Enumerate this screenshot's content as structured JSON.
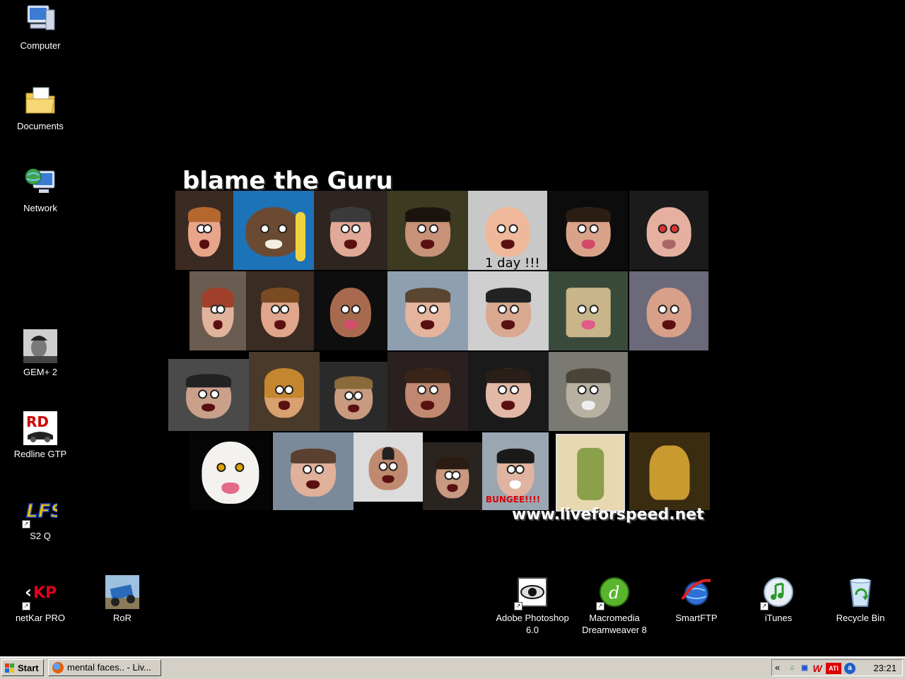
{
  "desktop": {
    "icons": {
      "computer": "Computer",
      "documents": "Documents",
      "network": "Network",
      "gem": "GEM+ 2",
      "redline": "Redline GTP",
      "s2q": "S2 Q",
      "netkar": "netKar PRO",
      "ror": "RoR",
      "photoshop_line1": "Adobe Photoshop",
      "photoshop_line2": "6.0",
      "dreamweaver_line1": "Macromedia",
      "dreamweaver_line2": "Dreamweaver 8",
      "smartftp": "SmartFTP",
      "itunes": "iTunes",
      "recycle": "Recycle Bin"
    },
    "wallpaper": {
      "title": "blame the Guru",
      "url": "www.liveforspeed.net",
      "caption": "1 day !!!",
      "bungee": "BUNGEE!!!!"
    }
  },
  "taskbar": {
    "start_label": "Start",
    "window_button": "mental faces.. - Liv...",
    "tray_chevron": "«",
    "clock": "23:21"
  },
  "icon_names": [
    "computer-icon",
    "folder-icon",
    "network-icon",
    "gem-icon",
    "redline-icon",
    "lfs-icon",
    "netkar-icon",
    "ror-icon",
    "photoshop-icon",
    "dreamweaver-icon",
    "smartftp-icon",
    "itunes-icon",
    "recycle-bin-icon"
  ],
  "colors": {
    "desktop_bg": "#000000",
    "taskbar_bg": "#d4d0c8"
  }
}
